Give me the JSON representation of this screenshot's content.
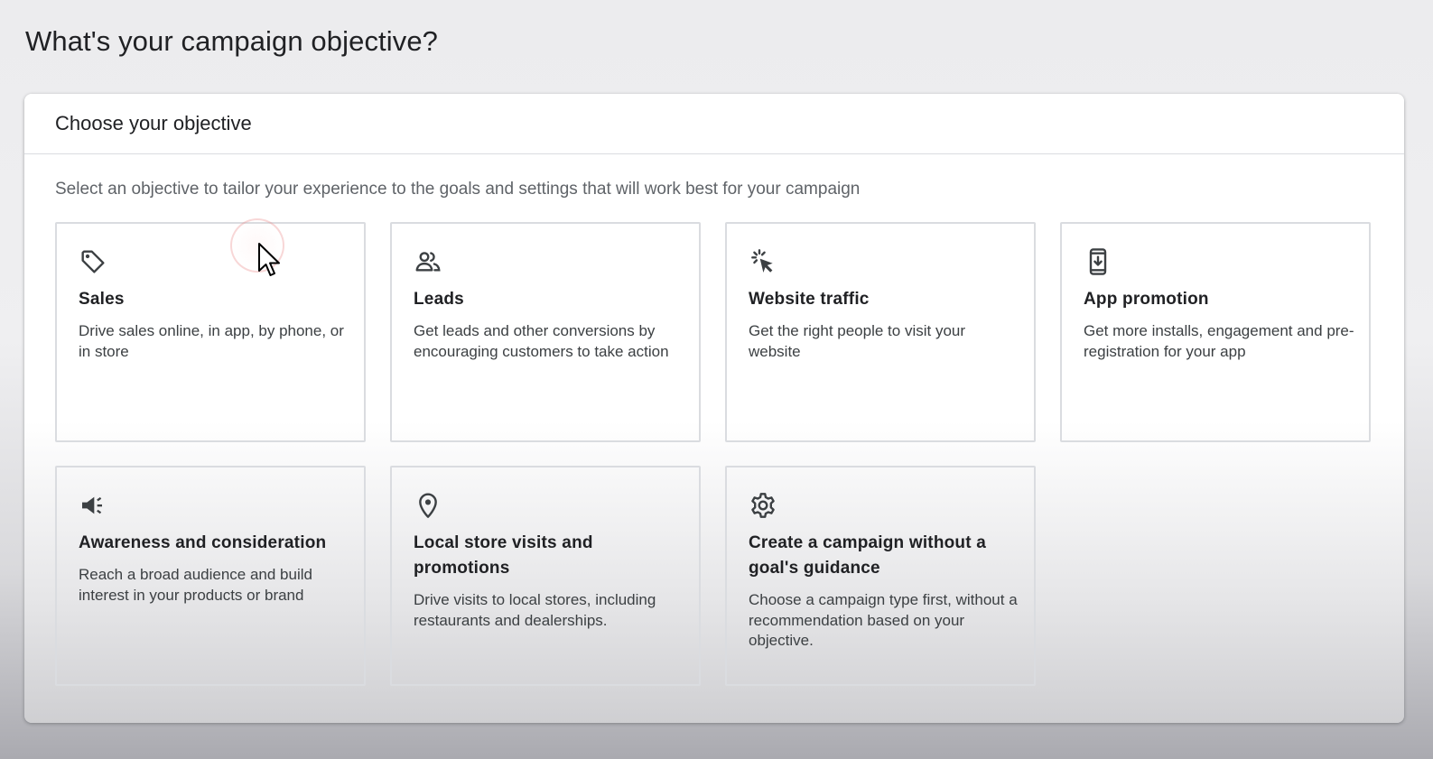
{
  "page_title": "What's your campaign objective?",
  "panel": {
    "title": "Choose your objective",
    "description": "Select an objective to tailor your experience to the goals and settings that will work best for your campaign"
  },
  "objectives": [
    {
      "icon": "tag-icon",
      "title": "Sales",
      "description": "Drive sales online, in app, by phone, or in store"
    },
    {
      "icon": "people-icon",
      "title": "Leads",
      "description": "Get leads and other conversions by encouraging customers to take action"
    },
    {
      "icon": "click-cursor-icon",
      "title": "Website traffic",
      "description": "Get the right people to visit your website"
    },
    {
      "icon": "phone-download-icon",
      "title": "App promotion",
      "description": "Get more installs, engagement and pre-registration for your app"
    },
    {
      "icon": "megaphone-icon",
      "title": "Awareness and consideration",
      "description": "Reach a broad audience and build interest in your products or brand"
    },
    {
      "icon": "location-pin-icon",
      "title": "Local store visits and promotions",
      "description": "Drive visits to local stores, including restaurants and dealerships."
    },
    {
      "icon": "gear-icon",
      "title": "Create a campaign without a goal's guidance",
      "description": "Choose a campaign type first, without a recommendation based on your objective."
    }
  ],
  "colors": {
    "text_primary": "#202124",
    "text_secondary": "#5f6368",
    "border": "#dadce0",
    "icon": "#3c4043"
  }
}
